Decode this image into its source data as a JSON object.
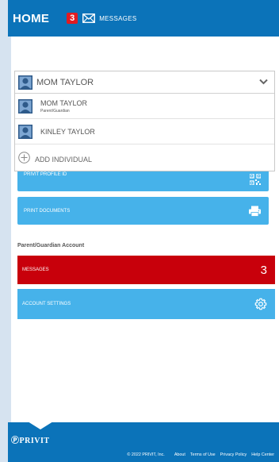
{
  "header": {
    "title": "HOME",
    "badge_count": "3",
    "messages_label": "MESSAGES"
  },
  "dropdown": {
    "selected": "MOM TAYLOR",
    "options": [
      {
        "name": "MOM TAYLOR",
        "role": "Parent/Guardian"
      },
      {
        "name": "KINLEY TAYLOR"
      }
    ],
    "add_label": "ADD INDIVIDUAL"
  },
  "buttons": {
    "profile_id": "PRIVIT PROFILE ID",
    "print_documents": "PRINT DOCUMENTS"
  },
  "account": {
    "section_label": "Parent/Guardian Account",
    "messages_label": "MESSAGES",
    "messages_count": "3",
    "settings_label": "ACCOUNT SETTINGS"
  },
  "footer": {
    "brand": "PRIVIT",
    "copyright": "© 2022 PRIVIT, Inc.",
    "links": [
      "About",
      "Terms of Use",
      "Privacy Policy",
      "Help Center"
    ]
  },
  "colors": {
    "primary": "#0b73b9",
    "accent": "#46b2ea",
    "alert": "#c8000b",
    "badge": "#e11b22"
  }
}
